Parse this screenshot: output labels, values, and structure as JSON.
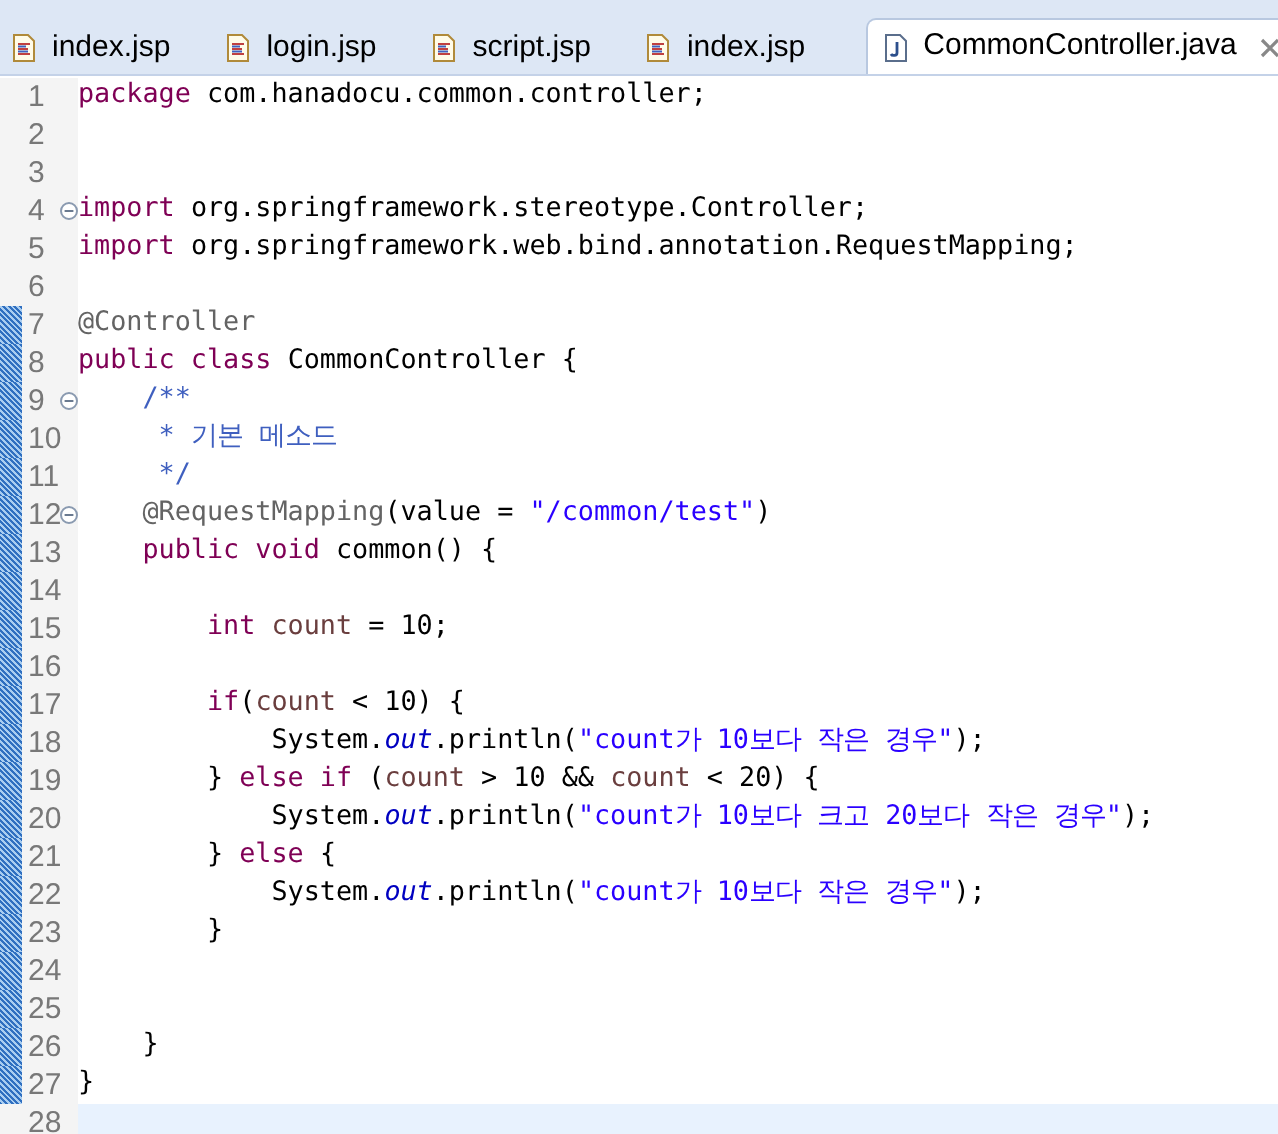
{
  "tabs": [
    {
      "label": "index.jsp",
      "kind": "jsp",
      "selected": false
    },
    {
      "label": "login.jsp",
      "kind": "jsp",
      "selected": false
    },
    {
      "label": "script.jsp",
      "kind": "jsp",
      "selected": false
    },
    {
      "label": "index.jsp",
      "kind": "jsp",
      "selected": false
    },
    {
      "label": "CommonController.java",
      "kind": "java",
      "selected": true
    }
  ],
  "editor": {
    "lines": [
      {
        "number": "1",
        "fold": false,
        "changed": false,
        "current": false,
        "tokens": [
          {
            "kind": "keyword",
            "text": "package "
          },
          {
            "kind": "plain",
            "text": "com.hanadocu.common.controller;"
          }
        ]
      },
      {
        "number": "2",
        "fold": false,
        "changed": false,
        "current": false
      },
      {
        "number": "3",
        "fold": false,
        "changed": false,
        "current": false
      },
      {
        "number": "4",
        "fold": true,
        "changed": false,
        "current": false,
        "tokens": [
          {
            "kind": "keyword",
            "text": "import "
          },
          {
            "kind": "plain",
            "text": "org.springframework.stereotype.Controller;"
          }
        ]
      },
      {
        "number": "5",
        "fold": false,
        "changed": false,
        "current": false,
        "tokens": [
          {
            "kind": "keyword",
            "text": "import "
          },
          {
            "kind": "plain",
            "text": "org.springframework.web.bind.annotation.RequestMapping;"
          }
        ]
      },
      {
        "number": "6",
        "fold": false,
        "changed": false,
        "current": false
      },
      {
        "number": "7",
        "fold": false,
        "changed": true,
        "current": false,
        "tokens": [
          {
            "kind": "annotation",
            "text": "@Controller"
          }
        ]
      },
      {
        "number": "8",
        "fold": false,
        "changed": true,
        "current": false,
        "tokens": [
          {
            "kind": "keyword",
            "text": "public class "
          },
          {
            "kind": "plain",
            "text": "CommonController {"
          }
        ]
      },
      {
        "number": "9",
        "fold": true,
        "changed": true,
        "current": false,
        "tokens": [
          {
            "kind": "comment",
            "text": "    /**"
          }
        ]
      },
      {
        "number": "10",
        "fold": false,
        "changed": true,
        "current": false,
        "tokens": [
          {
            "kind": "comment",
            "text": "     * 기본 메소드"
          }
        ]
      },
      {
        "number": "11",
        "fold": false,
        "changed": true,
        "current": false,
        "tokens": [
          {
            "kind": "comment",
            "text": "     */"
          }
        ]
      },
      {
        "number": "12",
        "fold": true,
        "changed": true,
        "current": false,
        "tokens": [
          {
            "kind": "annotation",
            "text": "    @RequestMapping"
          },
          {
            "kind": "plain",
            "text": "(value = "
          },
          {
            "kind": "string",
            "text": "\"/common/test\""
          },
          {
            "kind": "plain",
            "text": ")"
          }
        ]
      },
      {
        "number": "13",
        "fold": false,
        "changed": true,
        "current": false,
        "tokens": [
          {
            "kind": "keyword",
            "text": "    public void "
          },
          {
            "kind": "plain",
            "text": "common() {"
          }
        ]
      },
      {
        "number": "14",
        "fold": false,
        "changed": true,
        "current": false
      },
      {
        "number": "15",
        "fold": false,
        "changed": true,
        "current": false,
        "tokens": [
          {
            "kind": "keyword",
            "text": "        int "
          },
          {
            "kind": "variable",
            "text": "count"
          },
          {
            "kind": "plain",
            "text": " = 10;"
          }
        ]
      },
      {
        "number": "16",
        "fold": false,
        "changed": true,
        "current": false
      },
      {
        "number": "17",
        "fold": false,
        "changed": true,
        "current": false,
        "tokens": [
          {
            "kind": "keyword",
            "text": "        if"
          },
          {
            "kind": "plain",
            "text": "("
          },
          {
            "kind": "variable",
            "text": "count"
          },
          {
            "kind": "plain",
            "text": " < 10) {"
          }
        ]
      },
      {
        "number": "18",
        "fold": false,
        "changed": true,
        "current": false,
        "tokens": [
          {
            "kind": "plain",
            "text": "            System."
          },
          {
            "kind": "field",
            "text": "out"
          },
          {
            "kind": "plain",
            "text": ".println("
          },
          {
            "kind": "string",
            "text": "\"count가 10보다 작은 경우\""
          },
          {
            "kind": "plain",
            "text": ");"
          }
        ]
      },
      {
        "number": "19",
        "fold": false,
        "changed": true,
        "current": false,
        "tokens": [
          {
            "kind": "plain",
            "text": "        } "
          },
          {
            "kind": "keyword",
            "text": "else if "
          },
          {
            "kind": "plain",
            "text": "("
          },
          {
            "kind": "variable",
            "text": "count"
          },
          {
            "kind": "plain",
            "text": " > 10 && "
          },
          {
            "kind": "variable",
            "text": "count"
          },
          {
            "kind": "plain",
            "text": " < 20) {"
          }
        ]
      },
      {
        "number": "20",
        "fold": false,
        "changed": true,
        "current": false,
        "tokens": [
          {
            "kind": "plain",
            "text": "            System."
          },
          {
            "kind": "field",
            "text": "out"
          },
          {
            "kind": "plain",
            "text": ".println("
          },
          {
            "kind": "string",
            "text": "\"count가 10보다 크고 20보다 작은 경우\""
          },
          {
            "kind": "plain",
            "text": ");"
          }
        ]
      },
      {
        "number": "21",
        "fold": false,
        "changed": true,
        "current": false,
        "tokens": [
          {
            "kind": "plain",
            "text": "        } "
          },
          {
            "kind": "keyword",
            "text": "else "
          },
          {
            "kind": "plain",
            "text": "{"
          }
        ]
      },
      {
        "number": "22",
        "fold": false,
        "changed": true,
        "current": false,
        "tokens": [
          {
            "kind": "plain",
            "text": "            System."
          },
          {
            "kind": "field",
            "text": "out"
          },
          {
            "kind": "plain",
            "text": ".println("
          },
          {
            "kind": "string",
            "text": "\"count가 10보다 작은 경우\""
          },
          {
            "kind": "plain",
            "text": ");"
          }
        ]
      },
      {
        "number": "23",
        "fold": false,
        "changed": true,
        "current": false,
        "tokens": [
          {
            "kind": "plain",
            "text": "        }"
          }
        ]
      },
      {
        "number": "24",
        "fold": false,
        "changed": true,
        "current": false
      },
      {
        "number": "25",
        "fold": false,
        "changed": true,
        "current": false
      },
      {
        "number": "26",
        "fold": false,
        "changed": true,
        "current": false,
        "tokens": [
          {
            "kind": "plain",
            "text": "    }"
          }
        ]
      },
      {
        "number": "27",
        "fold": false,
        "changed": true,
        "current": false,
        "tokens": [
          {
            "kind": "plain",
            "text": "}"
          }
        ]
      },
      {
        "number": "28",
        "fold": false,
        "changed": false,
        "current": true
      }
    ]
  }
}
